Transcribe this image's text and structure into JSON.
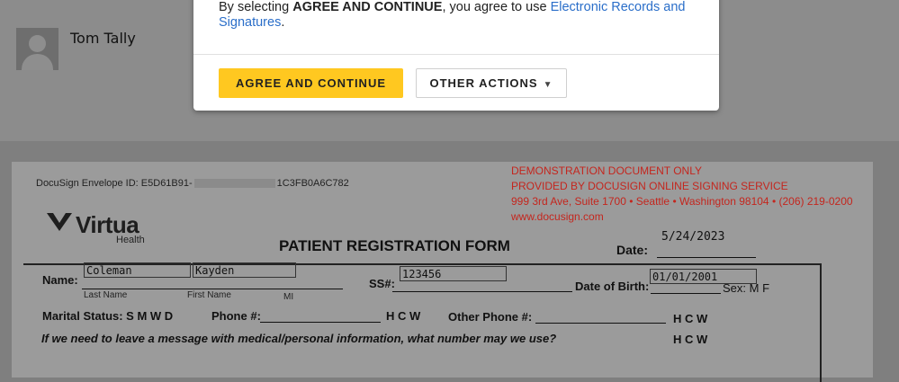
{
  "user": {
    "name": "Tom Tally"
  },
  "dialog": {
    "msg_prefix": "By selecting ",
    "msg_bold": "AGREE AND CONTINUE",
    "msg_mid": ", you agree to use ",
    "msg_link": "Electronic Records and Signatures",
    "msg_suffix": ".",
    "agree_label": "AGREE AND CONTINUE",
    "other_label": "OTHER ACTIONS"
  },
  "document": {
    "envelope_prefix": "DocuSign Envelope ID: E5D61B91-",
    "envelope_suffix": "1C3FB0A6C782",
    "demo_lines": [
      "DEMONSTRATION DOCUMENT ONLY",
      "PROVIDED BY DOCUSIGN ONLINE SIGNING SERVICE",
      "999 3rd Ave, Suite 1700  • Seattle • Washington 98104 • (206) 219-0200",
      "www.docusign.com"
    ],
    "logo_word": "Virtua",
    "logo_sub": "Health",
    "title": "PATIENT REGISTRATION FORM",
    "date_label": "Date:",
    "date_value": "5/24/2023",
    "name_label": "Name:",
    "last_name": "Coleman",
    "first_name": "Kayden",
    "last_name_caption": "Last Name",
    "first_name_caption": "First Name",
    "mi_caption": "MI",
    "ss_label": "SS#:",
    "ss_value": "123456",
    "dob_label": "Date of Birth:",
    "dob_value": "01/01/2001",
    "sex_label": "Sex:",
    "sex_options": "M  F",
    "marital_label": "Marital Status: S   M   W   D",
    "phone_label": "Phone #:",
    "phone_hcw": "H   C   W",
    "other_phone_label": "Other Phone #:",
    "other_hcw": "H    C    W",
    "question": "If we need to leave a message with medical/personal information, what number may we use?",
    "question_hcw": "H    C    W"
  }
}
